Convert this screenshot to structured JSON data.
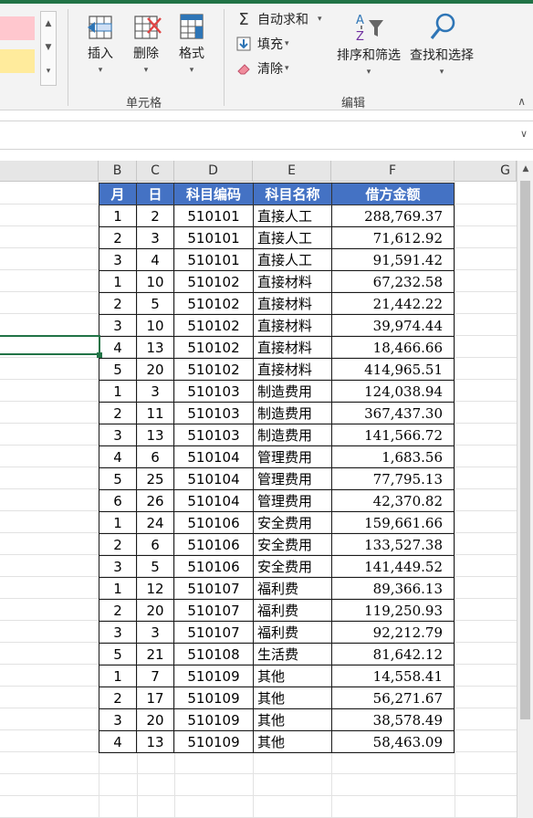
{
  "ribbon": {
    "cells_group": {
      "label": "单元格",
      "insert": "插入",
      "delete": "删除",
      "format": "格式"
    },
    "edit_group": {
      "label": "编辑",
      "autosum": "自动求和",
      "fill": "填充",
      "clear": "清除",
      "sort_filter": "排序和筛选",
      "find_select": "查找和选择"
    },
    "styles": {
      "swatch1_color": "#ffc7ce",
      "swatch2_color": "#ffeb9c"
    }
  },
  "grid": {
    "column_headers": [
      "B",
      "C",
      "D",
      "E",
      "F",
      "G"
    ],
    "table_headers": [
      "月",
      "日",
      "科目编码",
      "科目名称",
      "借方金额"
    ],
    "header_color": "#4472c4",
    "rows": [
      [
        "1",
        "2",
        "510101",
        "直接人工",
        "288,769.37"
      ],
      [
        "2",
        "3",
        "510101",
        "直接人工",
        "71,612.92"
      ],
      [
        "3",
        "4",
        "510101",
        "直接人工",
        "91,591.42"
      ],
      [
        "1",
        "10",
        "510102",
        "直接材料",
        "67,232.58"
      ],
      [
        "2",
        "5",
        "510102",
        "直接材料",
        "21,442.22"
      ],
      [
        "3",
        "10",
        "510102",
        "直接材料",
        "39,974.44"
      ],
      [
        "4",
        "13",
        "510102",
        "直接材料",
        "18,466.66"
      ],
      [
        "5",
        "20",
        "510102",
        "直接材料",
        "414,965.51"
      ],
      [
        "1",
        "3",
        "510103",
        "制造费用",
        "124,038.94"
      ],
      [
        "2",
        "11",
        "510103",
        "制造费用",
        "367,437.30"
      ],
      [
        "3",
        "13",
        "510103",
        "制造费用",
        "141,566.72"
      ],
      [
        "4",
        "6",
        "510104",
        "管理费用",
        "1,683.56"
      ],
      [
        "5",
        "25",
        "510104",
        "管理费用",
        "77,795.13"
      ],
      [
        "6",
        "26",
        "510104",
        "管理费用",
        "42,370.82"
      ],
      [
        "1",
        "24",
        "510106",
        "安全费用",
        "159,661.66"
      ],
      [
        "2",
        "6",
        "510106",
        "安全费用",
        "133,527.38"
      ],
      [
        "3",
        "5",
        "510106",
        "安全费用",
        "141,449.52"
      ],
      [
        "1",
        "12",
        "510107",
        "福利费",
        "89,366.13"
      ],
      [
        "2",
        "20",
        "510107",
        "福利费",
        "119,250.93"
      ],
      [
        "3",
        "3",
        "510107",
        "福利费",
        "92,212.79"
      ],
      [
        "5",
        "21",
        "510108",
        "生活费",
        "81,642.12"
      ],
      [
        "1",
        "7",
        "510109",
        "其他",
        "14,558.41"
      ],
      [
        "2",
        "17",
        "510109",
        "其他",
        "56,271.67"
      ],
      [
        "3",
        "20",
        "510109",
        "其他",
        "38,578.49"
      ],
      [
        "4",
        "13",
        "510109",
        "其他",
        "58,463.09"
      ]
    ]
  }
}
